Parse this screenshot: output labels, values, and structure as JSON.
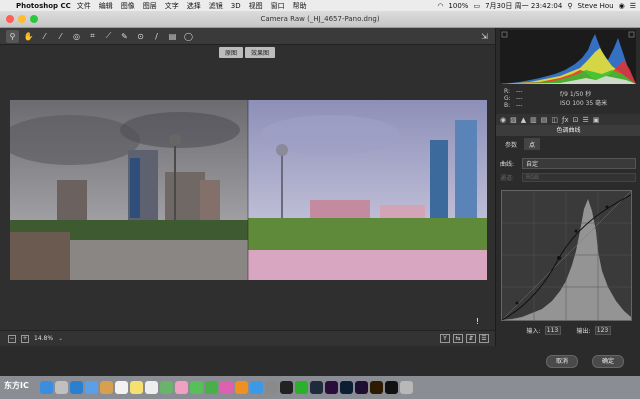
{
  "menubar": {
    "app": "Photoshop CC",
    "items": [
      "文件",
      "编辑",
      "图像",
      "图层",
      "文字",
      "选择",
      "滤镜",
      "3D",
      "视图",
      "窗口",
      "帮助"
    ],
    "battery": "100%",
    "datetime": "7月30日 周一 23:42:04",
    "user": "Steve Hou"
  },
  "window": {
    "title": "Camera Raw (_HJ_4657-Pano.dng)"
  },
  "compare": {
    "before": "原图",
    "after": "效果图"
  },
  "status": {
    "zoom": "14.8%"
  },
  "panel": {
    "readout": {
      "r": "R:",
      "g": "G:",
      "b": "B:",
      "dash": "---",
      "exposure": "f/9     1/50 秒",
      "iso": "ISO 100    35 毫米"
    },
    "section_title": "色调曲线",
    "tabs": [
      "参数",
      "点"
    ],
    "curve_label": "曲线:",
    "curve_value": "自定",
    "channel_label": "通道:",
    "channel_value": "RGB",
    "input_label": "输入:",
    "input_value": "113",
    "output_label": "输出:",
    "output_value": "123"
  },
  "buttons": {
    "cancel": "取消",
    "ok": "确定"
  },
  "watermark": "东方IC",
  "colors": {
    "dock_bg": "#8a8d93",
    "panel_bg": "#2b2b2b",
    "accent": "#4a90e2"
  },
  "dock_icons": [
    "finder",
    "launchpad",
    "safari",
    "mail",
    "contacts",
    "calendar",
    "notes",
    "reminders",
    "maps",
    "photos",
    "messages",
    "facetime",
    "itunes",
    "ibooks",
    "appstore",
    "preferences",
    "qq",
    "wechat",
    "lightroom",
    "premiere",
    "photoshop",
    "aftereffects",
    "illustrator",
    "terminal",
    "trash"
  ]
}
